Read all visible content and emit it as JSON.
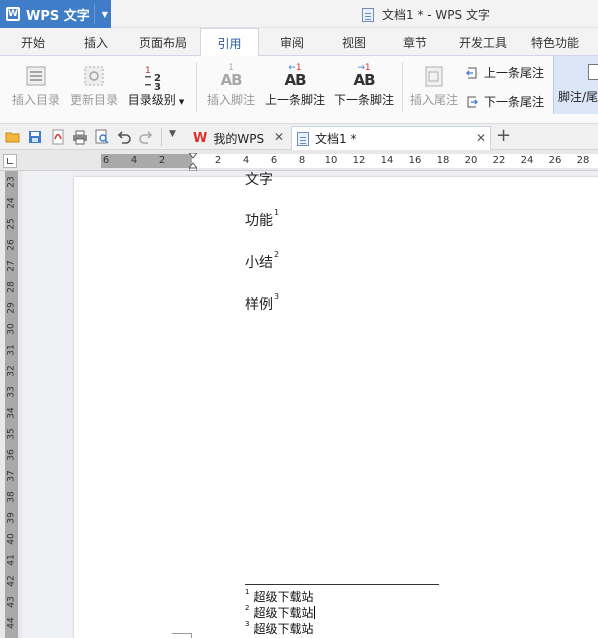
{
  "app": {
    "name": "WPS 文字",
    "logo": "W"
  },
  "window": {
    "title": "文档1 * - WPS 文字"
  },
  "menu": {
    "tabs": [
      "开始",
      "插入",
      "页面布局",
      "引用",
      "审阅",
      "视图",
      "章节",
      "开发工具",
      "特色功能"
    ],
    "active": "引用"
  },
  "ribbon": {
    "insert_toc": "插入目录",
    "update_toc": "更新目录",
    "toc_level": "目录级别",
    "insert_footnote": "插入脚注",
    "prev_footnote": "上一条脚注",
    "next_footnote": "下一条脚注",
    "insert_endnote": "插入尾注",
    "prev_endnote": "上一条尾注",
    "next_endnote": "下一条尾注",
    "footnote_endnote": "脚注/尾",
    "ab": "AB",
    "one": "1",
    "toc_icon_numbers": [
      "1",
      "2",
      "3"
    ]
  },
  "tabs": {
    "my_wps": "我的WPS",
    "doc": "文档1 *"
  },
  "ruler": {
    "h_labels": [
      "6",
      "4",
      "2",
      "2",
      "4",
      "6",
      "8",
      "10",
      "12",
      "14",
      "16",
      "18",
      "20",
      "22",
      "24",
      "26",
      "28"
    ],
    "v_labels": [
      "23",
      "24",
      "25",
      "26",
      "27",
      "28",
      "29",
      "30",
      "31",
      "32",
      "33",
      "34",
      "35",
      "36",
      "37",
      "38",
      "39",
      "40",
      "41",
      "42",
      "43",
      "44"
    ]
  },
  "document": {
    "lines": [
      {
        "text": "文字",
        "mark": ""
      },
      {
        "text": "功能",
        "mark": "1"
      },
      {
        "text": "小结",
        "mark": "2"
      },
      {
        "text": "样例",
        "mark": "3"
      }
    ],
    "footnotes": [
      {
        "mark": "1",
        "text": "超级下载站"
      },
      {
        "mark": "2",
        "text": "超级下载站"
      },
      {
        "mark": "3",
        "text": "超级下载站"
      }
    ]
  },
  "colors": {
    "accent": "#3f7dc8",
    "active_tab_text": "#2a5ba8",
    "wps_red": "#d9302c"
  }
}
